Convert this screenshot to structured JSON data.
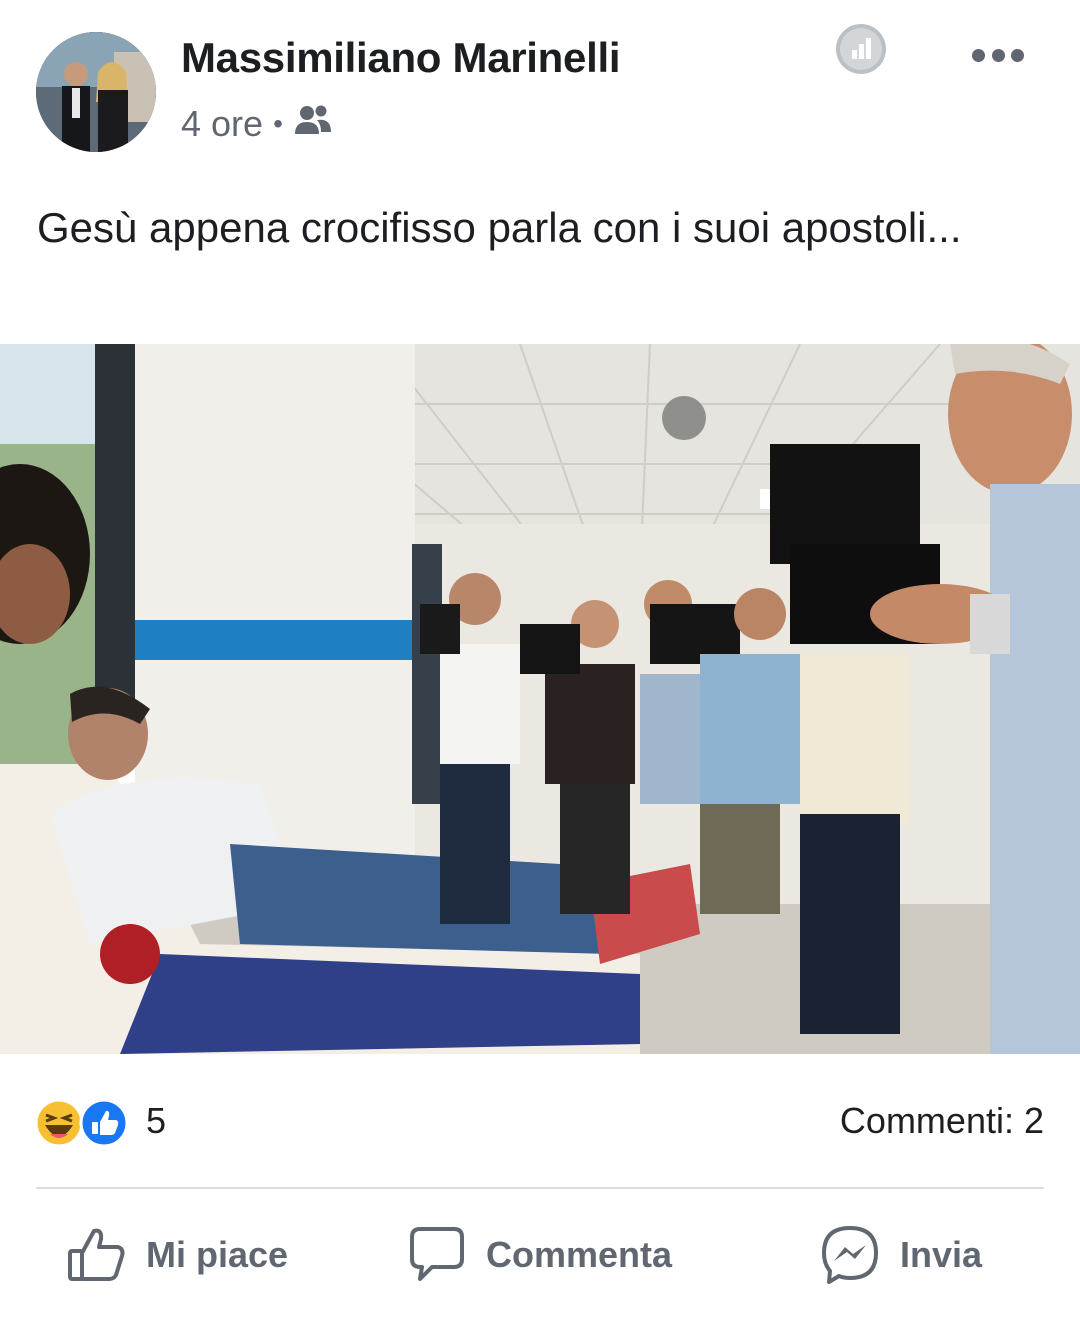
{
  "post": {
    "author": "Massimiliano Marinelli",
    "time": "4 ore",
    "separator": "•",
    "audience_icon": "friends-icon",
    "text": "Gesù appena crocifisso parla con i suoi apostoli..."
  },
  "reactions": {
    "icons": [
      "haha-icon",
      "like-icon"
    ],
    "count": "5",
    "comments": "Commenti: 2"
  },
  "actions": {
    "like": "Mi piace",
    "comment": "Commenta",
    "share": "Invia"
  },
  "colors": {
    "text": "#1c1e21",
    "secondary": "#606770",
    "like_blue": "#1877f2",
    "haha_yellow": "#f7c033",
    "divider": "#dadde1"
  }
}
